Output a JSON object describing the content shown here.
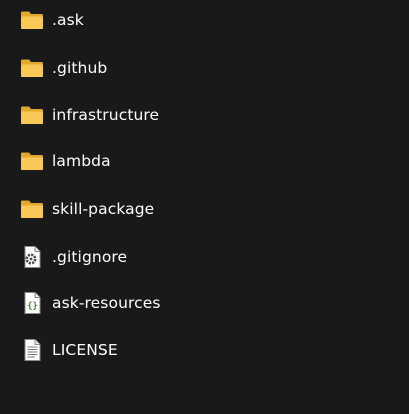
{
  "items": [
    {
      "name": ".ask",
      "icon": "folder-icon"
    },
    {
      "name": ".github",
      "icon": "folder-icon"
    },
    {
      "name": "infrastructure",
      "icon": "folder-icon"
    },
    {
      "name": "lambda",
      "icon": "folder-icon"
    },
    {
      "name": "skill-package",
      "icon": "folder-icon"
    },
    {
      "name": ".gitignore",
      "icon": "settings-file-icon"
    },
    {
      "name": "ask-resources",
      "icon": "json-file-icon"
    },
    {
      "name": "LICENSE",
      "icon": "text-file-icon"
    }
  ],
  "colors": {
    "background": "#191919",
    "text": "#ffffff",
    "folder": "#f4c64f"
  }
}
